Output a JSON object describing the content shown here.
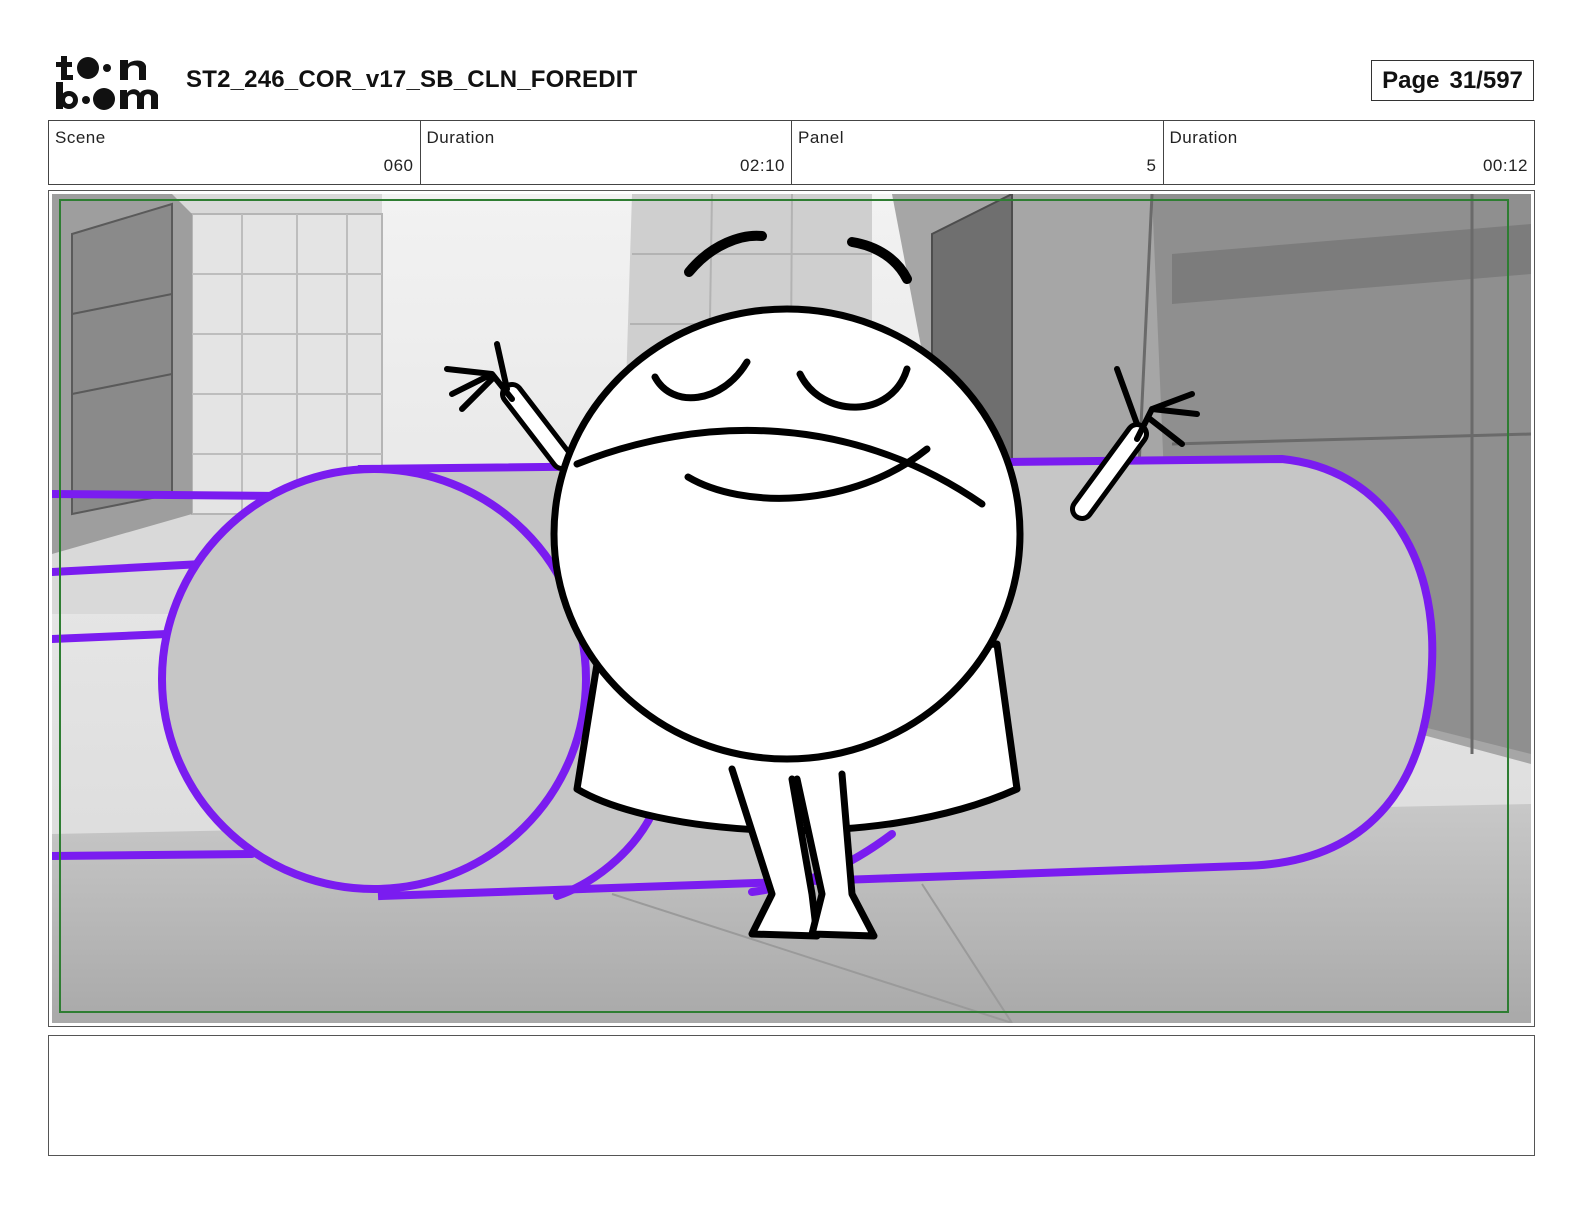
{
  "header": {
    "logo_text": "toon boom",
    "title": "ST2_246_COR_v17_SB_CLN_FOREDIT",
    "page_label": "Page",
    "page_value": "31/597"
  },
  "info": {
    "scene_label": "Scene",
    "scene_value": "060",
    "scene_duration_label": "Duration",
    "scene_duration_value": "02:10",
    "panel_label": "Panel",
    "panel_value": "5",
    "panel_duration_label": "Duration",
    "panel_duration_value": "00:12"
  },
  "panel": {
    "background_color": "#c2c2c2",
    "safe_frame_color": "#2e7d32",
    "outline_color": "#7a1cf0",
    "ink_color": "#000000"
  },
  "notes": {
    "text": ""
  }
}
